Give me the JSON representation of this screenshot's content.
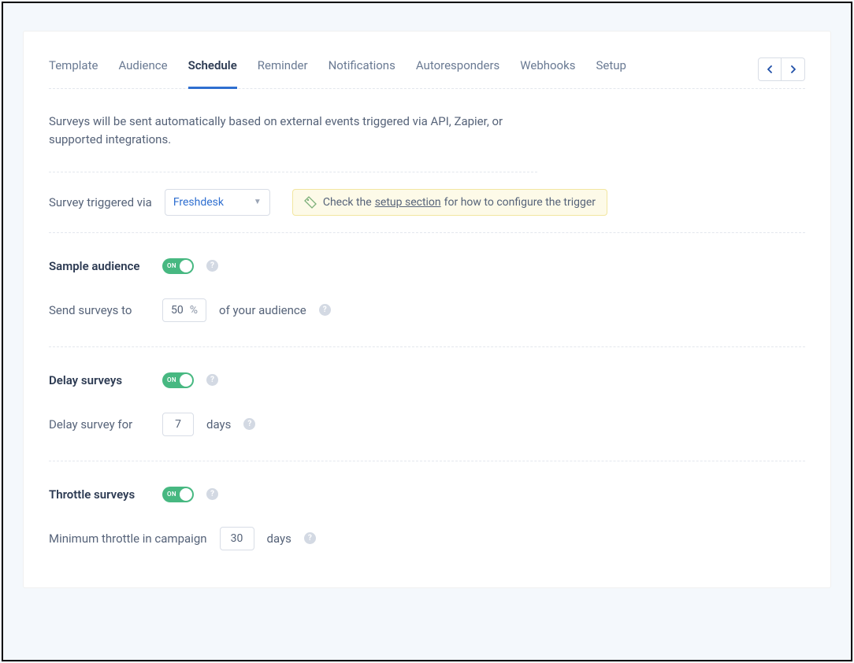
{
  "tabs": {
    "items": [
      "Template",
      "Audience",
      "Schedule",
      "Reminder",
      "Notifications",
      "Autoresponders",
      "Webhooks",
      "Setup"
    ],
    "active_index": 2
  },
  "intro": "Surveys will be sent automatically based on external events triggered via API, Zapier, or supported integrations.",
  "trigger": {
    "label": "Survey triggered via",
    "value": "Freshdesk",
    "hint_prefix": "Check the ",
    "hint_link": "setup section",
    "hint_suffix": " for how to configure the trigger"
  },
  "sample": {
    "title": "Sample audience",
    "toggle_on": "ON",
    "send_label": "Send surveys to",
    "value": "50",
    "unit": "%",
    "suffix": "of your audience"
  },
  "delay": {
    "title": "Delay surveys",
    "toggle_on": "ON",
    "field_label": "Delay survey for",
    "value": "7",
    "unit": "days"
  },
  "throttle": {
    "title": "Throttle surveys",
    "toggle_on": "ON",
    "field_label": "Minimum throttle in campaign",
    "value": "30",
    "unit": "days"
  }
}
